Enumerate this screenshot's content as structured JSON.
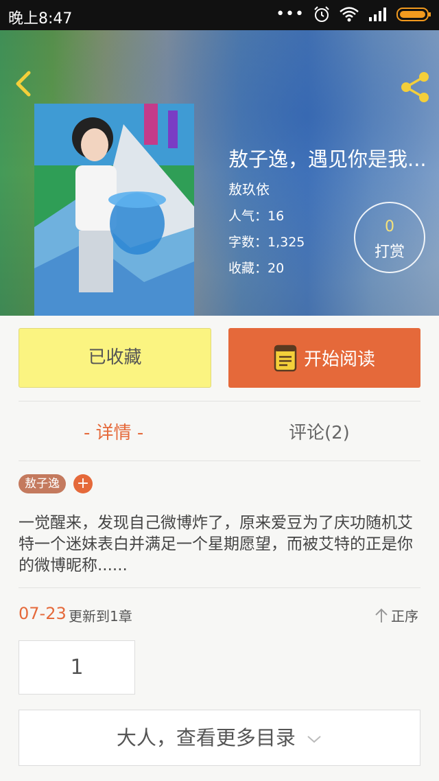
{
  "status_bar": {
    "time": "晚上8:47"
  },
  "book": {
    "title": "敖子逸，遇见你是我...",
    "author": "敖玖依",
    "popularity": "人气：16",
    "word_count": "字数：1,325",
    "favorites": "收藏：20",
    "tip_count": "0",
    "tip_label": "打赏"
  },
  "actions": {
    "favorited_label": "已收藏",
    "start_reading_label": "开始阅读"
  },
  "tabs": [
    {
      "label": "- 详情 -",
      "active": true
    },
    {
      "label": "评论(2)",
      "active": false
    }
  ],
  "tag": {
    "label": "敖子逸",
    "add": "+"
  },
  "description": "一觉醒来，发现自己微博炸了，原来爱豆为了庆功随机艾特一个迷妹表白并满足一个星期愿望，而被艾特的正是你的微博昵称......",
  "update": {
    "date": "07-23",
    "text": "更新到1章",
    "sort_label": "正序"
  },
  "chapters": [
    "1"
  ],
  "more_catalog_label": "大人，查看更多目录",
  "colors": {
    "accent": "#e5693a",
    "fav_yellow": "#fbf481",
    "tag": "#c47a5e"
  }
}
